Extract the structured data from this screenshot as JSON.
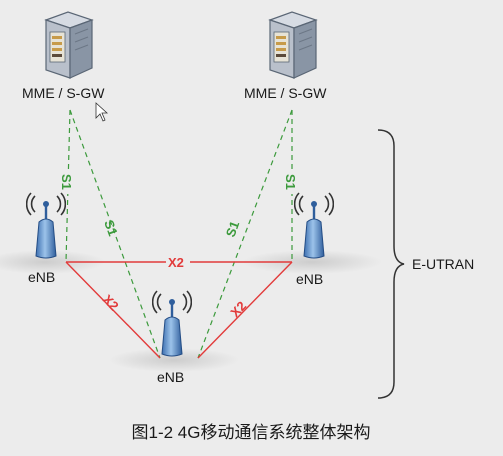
{
  "nodes": {
    "mme_left": {
      "label": "MME / S-GW",
      "icon": "server-icon"
    },
    "mme_right": {
      "label": "MME / S-GW",
      "icon": "server-icon"
    },
    "enb_left": {
      "label": "eNB",
      "icon": "antenna-icon"
    },
    "enb_right": {
      "label": "eNB",
      "icon": "antenna-icon"
    },
    "enb_bottom": {
      "label": "eNB",
      "icon": "antenna-icon"
    }
  },
  "links": {
    "s1": "S1",
    "x2": "X2"
  },
  "colors": {
    "s1_link": "#3c9a3c",
    "x2_link": "#e23b3b",
    "background": "#ececec"
  },
  "region_label": "E-UTRAN",
  "caption": "图1-2  4G移动通信系统整体架构"
}
